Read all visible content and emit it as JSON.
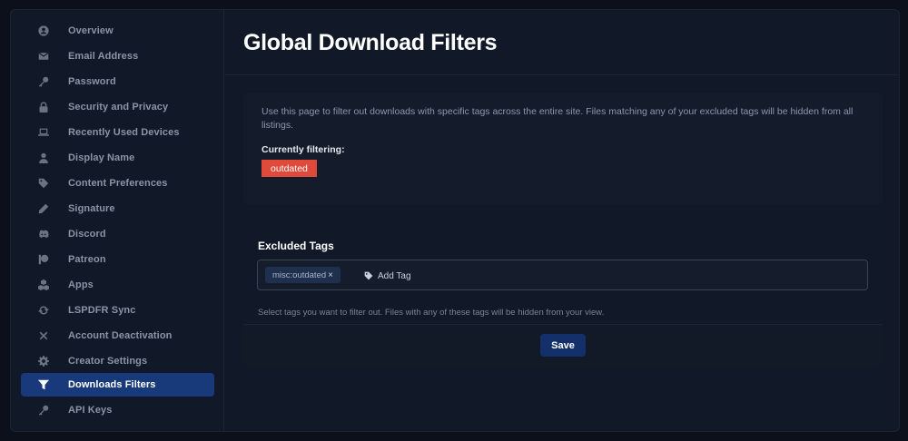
{
  "sidebar": {
    "items": [
      {
        "label": "Overview",
        "icon": "user-circle-icon",
        "active": false
      },
      {
        "label": "Email Address",
        "icon": "envelope-icon",
        "active": false
      },
      {
        "label": "Password",
        "icon": "key-icon",
        "active": false
      },
      {
        "label": "Security and Privacy",
        "icon": "lock-icon",
        "active": false
      },
      {
        "label": "Recently Used Devices",
        "icon": "laptop-icon",
        "active": false
      },
      {
        "label": "Display Name",
        "icon": "user-icon",
        "active": false
      },
      {
        "label": "Content Preferences",
        "icon": "tag-icon",
        "active": false
      },
      {
        "label": "Signature",
        "icon": "pencil-icon",
        "active": false
      },
      {
        "label": "Discord",
        "icon": "discord-icon",
        "active": false
      },
      {
        "label": "Patreon",
        "icon": "patreon-icon",
        "active": false
      },
      {
        "label": "Apps",
        "icon": "cubes-icon",
        "active": false
      },
      {
        "label": "LSPDFR Sync",
        "icon": "sync-icon",
        "active": false
      },
      {
        "label": "Account Deactivation",
        "icon": "close-icon",
        "active": false
      },
      {
        "label": "Creator Settings",
        "icon": "gear-icon",
        "active": false
      },
      {
        "label": "Downloads Filters",
        "icon": "filter-icon",
        "active": true
      },
      {
        "label": "API Keys",
        "icon": "key-icon",
        "active": false
      }
    ]
  },
  "header": {
    "title": "Global Download Filters"
  },
  "info": {
    "description": "Use this page to filter out downloads with specific tags across the entire site. Files matching any of your excluded tags will be hidden from all listings.",
    "filtering_label": "Currently filtering:",
    "badges": [
      "outdated"
    ],
    "badge_color": "#e04a3a"
  },
  "excluded_tags": {
    "title": "Excluded Tags",
    "tags": [
      "misc:outdated"
    ],
    "remove_symbol": "×",
    "add_label": "Add Tag",
    "add_icon": "tag-icon",
    "help": "Select tags you want to filter out. Files with any of these tags will be hidden from your view."
  },
  "footer": {
    "save_label": "Save"
  },
  "colors": {
    "accent": "#193a7a",
    "save_button": "#14306b"
  }
}
